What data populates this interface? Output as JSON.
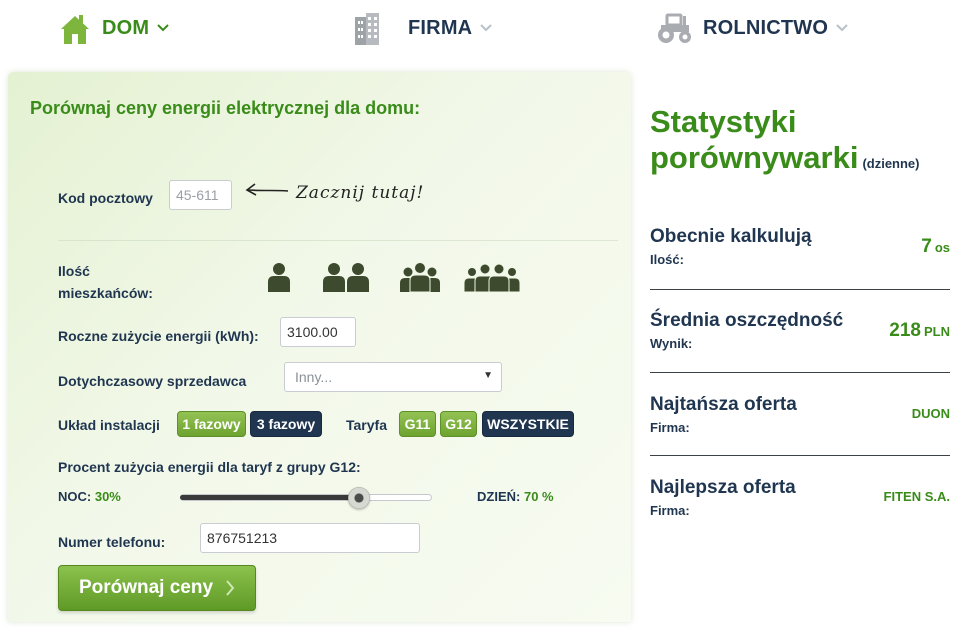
{
  "nav": {
    "dom": "DOM",
    "firma": "FIRMA",
    "rolnictwo": "ROLNICTWO"
  },
  "form": {
    "title": "Porównaj ceny energii elektrycznej dla domu:",
    "zip": {
      "label": "Kod pocztowy",
      "placeholder": "45-611"
    },
    "hint": "Zacznij tutaj!",
    "residents": {
      "label": "Ilość mieszkańców:",
      "options": [
        1,
        2,
        3,
        4
      ]
    },
    "usage": {
      "label": "Roczne zużycie energii (kWh):",
      "value": "3100.00"
    },
    "supplier": {
      "label": "Dotychczasowy sprzedawca",
      "selected": "Inny..."
    },
    "installation": {
      "label": "Układ instalacji",
      "options": [
        "1 fazowy",
        "3 fazowy"
      ],
      "selected": "3 fazowy"
    },
    "tariff": {
      "label": "Taryfa",
      "options": [
        "G11",
        "G12",
        "WSZYSTKIE"
      ],
      "selected": "WSZYSTKIE"
    },
    "g12": {
      "label": "Procent zużycia energii dla taryf z grupy G12:",
      "night_label": "NOC:",
      "night_value": "30%",
      "day_label": "DZIEŃ:",
      "day_value": "70 %",
      "night_fraction": 0.71
    },
    "phone": {
      "label": "Numer telefonu:",
      "value": "876751213"
    },
    "submit": "Porównaj ceny"
  },
  "stats": {
    "title": "Statystyki porównywarki",
    "subtitle": "(dzienne)",
    "rows": [
      {
        "title": "Obecnie kalkulują",
        "sub": "Ilość:",
        "value": "7",
        "unit": "os"
      },
      {
        "title": "Średnia oszczędność",
        "sub": "Wynik:",
        "value": "218",
        "unit": "PLN"
      },
      {
        "title": "Najtańsza oferta",
        "sub": "Firma:",
        "value": "DUON",
        "unit": ""
      },
      {
        "title": "Najlepsza oferta",
        "sub": "Firma:",
        "value": "FITEN S.A.",
        "unit": ""
      }
    ]
  },
  "colors": {
    "accent_green": "#3a8c1a",
    "navy": "#1f3550",
    "pill_green": "#7db53d"
  },
  "icons": {
    "nav_dom": "house-icon",
    "nav_firma": "office-building-icon",
    "nav_rolnictwo": "tractor-icon",
    "hint_arrow": "hand-drawn-arrow-icon",
    "submit_chevron": "chevron-right-icon"
  }
}
